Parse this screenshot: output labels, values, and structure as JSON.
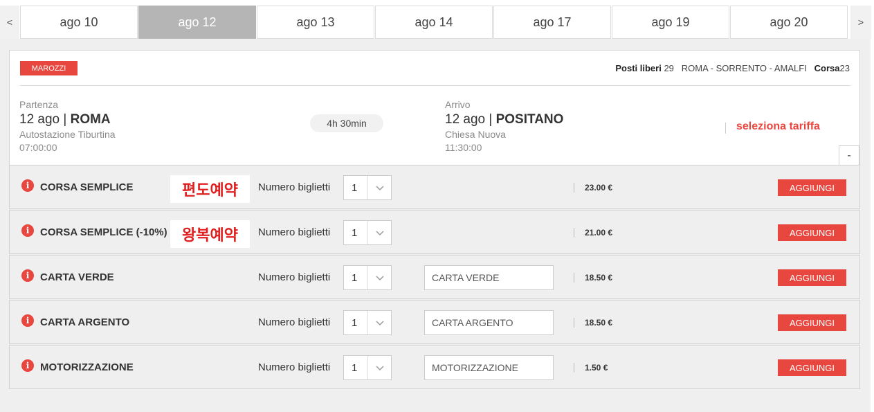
{
  "dates": {
    "prev_arrow": "<",
    "next_arrow": ">",
    "tabs": [
      {
        "label": "ago 10"
      },
      {
        "label": "ago 12"
      },
      {
        "label": "ago 13"
      },
      {
        "label": "ago 14"
      },
      {
        "label": "ago 17"
      },
      {
        "label": "ago 19"
      },
      {
        "label": "ago 20"
      }
    ],
    "active_index": 1
  },
  "trip": {
    "operator": "MAROZZI",
    "seats_label": "Posti liberi",
    "seats_value": "29",
    "route": "ROMA - SORRENTO - AMALFI",
    "run_label": "Corsa",
    "run_value": "23",
    "departure": {
      "label": "Partenza",
      "date": "12 ago |",
      "city": "ROMA",
      "station": "Autostazione Tiburtina",
      "time": "07:00:00"
    },
    "duration": "4h 30min",
    "arrival": {
      "label": "Arrivo",
      "date": "12 ago |",
      "city": "POSITANO",
      "station": "Chiesa Nuova",
      "time": "11:30:00"
    },
    "select_fare": "seleziona tariffa",
    "collapse": "-"
  },
  "fares": [
    {
      "name": "CORSA SEMPLICE",
      "annotation": "편도예약",
      "qty_label": "Numero biglietti",
      "qty": "1",
      "card_placeholder": "",
      "price": "23.00 €",
      "add": "AGGIUNGI"
    },
    {
      "name": "CORSA SEMPLICE (-10%)",
      "annotation": "왕복예약",
      "qty_label": "Numero biglietti",
      "qty": "1",
      "card_placeholder": "",
      "price": "21.00 €",
      "add": "AGGIUNGI"
    },
    {
      "name": "CARTA VERDE",
      "annotation": "",
      "qty_label": "Numero biglietti",
      "qty": "1",
      "card_placeholder": "CARTA VERDE",
      "price": "18.50 €",
      "add": "AGGIUNGI"
    },
    {
      "name": "CARTA ARGENTO",
      "annotation": "",
      "qty_label": "Numero biglietti",
      "qty": "1",
      "card_placeholder": "CARTA ARGENTO",
      "price": "18.50 €",
      "add": "AGGIUNGI"
    },
    {
      "name": "MOTORIZZAZIONE",
      "annotation": "",
      "qty_label": "Numero biglietti",
      "qty": "1",
      "card_placeholder": "MOTORIZZAZIONE",
      "price": "1.50 €",
      "add": "AGGIUNGI"
    }
  ],
  "colors": {
    "accent": "#e8473f",
    "active_tab": "#b5b5b5",
    "panel_bg": "#efefef"
  }
}
